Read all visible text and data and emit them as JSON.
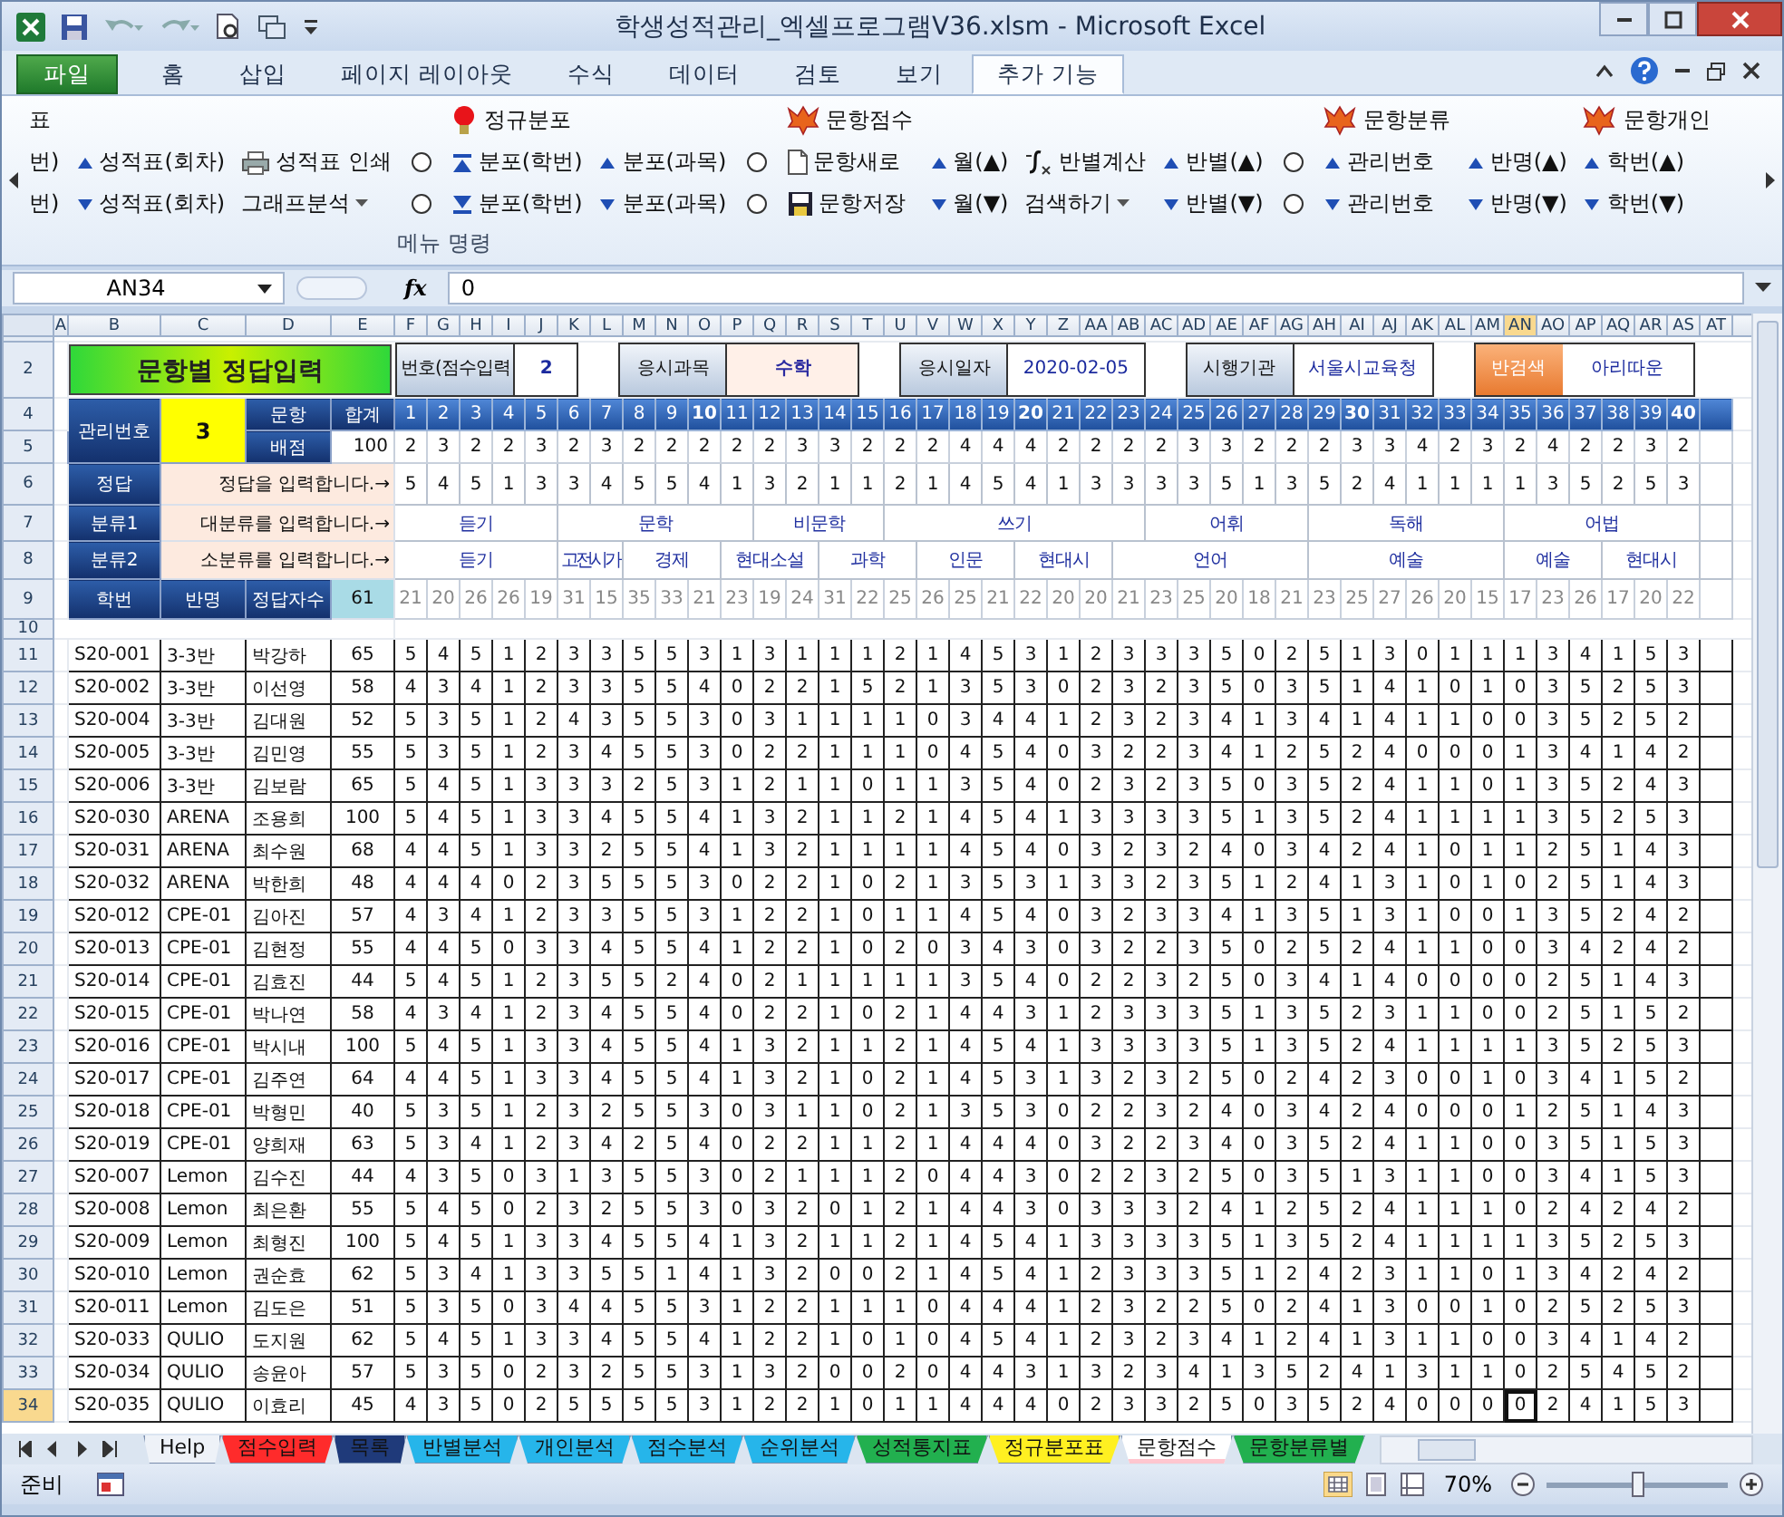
{
  "window": {
    "title": "학생성적관리_엑셀프로그램V36.xlsm  -  Microsoft Excel"
  },
  "ribbon_tabs": [
    {
      "label": "파일",
      "kind": "file",
      "selected": false
    },
    {
      "label": "홈",
      "selected": false
    },
    {
      "label": "삽입",
      "selected": false
    },
    {
      "label": "페이지 레이아웃",
      "selected": false
    },
    {
      "label": "수식",
      "selected": false
    },
    {
      "label": "데이터",
      "selected": false
    },
    {
      "label": "검토",
      "selected": false
    },
    {
      "label": "보기",
      "selected": false
    },
    {
      "label": "추가 기능",
      "selected": true
    }
  ],
  "ribbon": {
    "group_label": "메뉴 명령",
    "columns": [
      {
        "top": {
          "kind": "text",
          "label": "표"
        },
        "mid": {
          "kind": "text",
          "label": "번)"
        },
        "bot": {
          "kind": "text",
          "label": "번)"
        }
      },
      {
        "mid": {
          "kind": "up",
          "label": "성적표(회차)"
        },
        "bot": {
          "kind": "down",
          "label": "성적표(회차)"
        }
      },
      {
        "mid": {
          "kind": "printer",
          "label": "성적표 인쇄"
        },
        "bot": {
          "kind": "dropdown",
          "label": "그래프분석"
        }
      },
      {
        "mid": {
          "kind": "radio",
          "selected": false
        },
        "bot": {
          "kind": "radio",
          "selected": false
        }
      },
      {
        "top": {
          "kind": "bulb",
          "label": "정규분포"
        },
        "mid": {
          "kind": "bar-up",
          "label": "분포(학번)"
        },
        "bot": {
          "kind": "bar-down",
          "label": "분포(학번)"
        }
      },
      {
        "mid": {
          "kind": "up",
          "label": "분포(과목)"
        },
        "bot": {
          "kind": "down",
          "label": "분포(과목)"
        }
      },
      {
        "mid": {
          "kind": "radio",
          "selected": false
        },
        "bot": {
          "kind": "radio",
          "selected": false
        }
      },
      {
        "top": {
          "kind": "fox",
          "label": "문항점수"
        },
        "mid": {
          "kind": "doc",
          "label": "문항새로"
        },
        "bot": {
          "kind": "save",
          "label": "문항저장"
        }
      },
      {
        "mid": {
          "kind": "up",
          "label": "월(▲)"
        },
        "bot": {
          "kind": "down",
          "label": "월(▼)"
        }
      },
      {
        "mid": {
          "kind": "formula",
          "label": "반별계산"
        },
        "bot": {
          "kind": "dropdown",
          "label": "검색하기"
        }
      },
      {
        "mid": {
          "kind": "up",
          "label": "반별(▲)"
        },
        "bot": {
          "kind": "down",
          "label": "반별(▼)"
        }
      },
      {
        "mid": {
          "kind": "radio",
          "selected": false
        },
        "bot": {
          "kind": "radio",
          "selected": false
        }
      },
      {
        "top": {
          "kind": "fox",
          "label": "문항분류"
        },
        "mid": {
          "kind": "up",
          "label": "관리번호"
        },
        "bot": {
          "kind": "down",
          "label": "관리번호"
        }
      },
      {
        "mid": {
          "kind": "up",
          "label": "반명(▲)"
        },
        "bot": {
          "kind": "down",
          "label": "반명(▼)"
        }
      },
      {
        "top": {
          "kind": "fox",
          "label": "문항개인"
        },
        "mid": {
          "kind": "up",
          "label": "학번(▲)"
        },
        "bot": {
          "kind": "down",
          "label": "학번(▼)"
        }
      }
    ]
  },
  "formula_bar": {
    "name_box": "AN34",
    "fx": "fx",
    "value": "0"
  },
  "sheet": {
    "columns": [
      {
        "label": "A",
        "selected": false
      },
      {
        "label": "B",
        "selected": false
      },
      {
        "label": "C",
        "selected": false
      },
      {
        "label": "D",
        "selected": false
      },
      {
        "label": "E",
        "selected": false
      },
      {
        "label": "F",
        "selected": false
      },
      {
        "label": "G",
        "selected": false
      },
      {
        "label": "H",
        "selected": false
      },
      {
        "label": "I",
        "selected": false
      },
      {
        "label": "J",
        "selected": false
      },
      {
        "label": "K",
        "selected": false
      },
      {
        "label": "L",
        "selected": false
      },
      {
        "label": "M",
        "selected": false
      },
      {
        "label": "N",
        "selected": false
      },
      {
        "label": "O",
        "selected": false
      },
      {
        "label": "P",
        "selected": false
      },
      {
        "label": "Q",
        "selected": false
      },
      {
        "label": "R",
        "selected": false
      },
      {
        "label": "S",
        "selected": false
      },
      {
        "label": "T",
        "selected": false
      },
      {
        "label": "U",
        "selected": false
      },
      {
        "label": "V",
        "selected": false
      },
      {
        "label": "W",
        "selected": false
      },
      {
        "label": "X",
        "selected": false
      },
      {
        "label": "Y",
        "selected": false
      },
      {
        "label": "Z",
        "selected": false
      },
      {
        "label": "AA",
        "selected": false
      },
      {
        "label": "AB",
        "selected": false
      },
      {
        "label": "AC",
        "selected": false
      },
      {
        "label": "AD",
        "selected": false
      },
      {
        "label": "AE",
        "selected": false
      },
      {
        "label": "AF",
        "selected": false
      },
      {
        "label": "AG",
        "selected": false
      },
      {
        "label": "AH",
        "selected": false
      },
      {
        "label": "AI",
        "selected": false
      },
      {
        "label": "AJ",
        "selected": false
      },
      {
        "label": "AK",
        "selected": false
      },
      {
        "label": "AL",
        "selected": false
      },
      {
        "label": "AM",
        "selected": false
      },
      {
        "label": "AN",
        "selected": true
      },
      {
        "label": "AO",
        "selected": false
      },
      {
        "label": "AP",
        "selected": false
      },
      {
        "label": "AQ",
        "selected": false
      },
      {
        "label": "AR",
        "selected": false
      },
      {
        "label": "AS",
        "selected": false
      },
      {
        "label": "AT",
        "selected": false
      }
    ],
    "header_rows": [
      "2",
      "4",
      "5",
      "6",
      "7",
      "8",
      "9",
      "10"
    ],
    "title": "문항별 정답입력",
    "info": [
      {
        "label": "번호(점수입력",
        "value": "2",
        "kind": "plain"
      },
      {
        "label": "응시과목",
        "value": "수학",
        "kind": "highlight"
      },
      {
        "label": "응시일자",
        "value": "2020-02-05",
        "kind": "plain"
      },
      {
        "label": "시행기관",
        "value": "서울시교육청",
        "kind": "plain"
      },
      {
        "label": "반검색",
        "value": "아리따운",
        "kind": "search"
      }
    ],
    "header": {
      "manage_label": "관리번호",
      "manage_value": "3",
      "question_label": "문항",
      "total_label": "합계",
      "points_label": "배점",
      "points_total": "100",
      "answer_label": "정답",
      "answer_hint": "정답을 입력합니다.→",
      "cat1_label": "분류1",
      "cat1_hint": "대분류를 입력합니다.→",
      "cat2_label": "분류2",
      "cat2_hint": "소분류를 입력합니다.→",
      "id_label": "학번",
      "class_label": "반명",
      "count_label": "정답자수",
      "count_value": "61"
    },
    "questions": [
      {
        "number": "1",
        "points": "2",
        "answer": "5",
        "correct": "21",
        "category1": "듣기",
        "category2": "듣기"
      },
      {
        "number": "2",
        "points": "3",
        "answer": "4",
        "correct": "20"
      },
      {
        "number": "3",
        "points": "2",
        "answer": "5",
        "correct": "26"
      },
      {
        "number": "4",
        "points": "2",
        "answer": "1",
        "correct": "26"
      },
      {
        "number": "5",
        "points": "3",
        "answer": "3",
        "correct": "19"
      },
      {
        "number": "6",
        "points": "2",
        "answer": "3",
        "correct": "31",
        "category1": "문학",
        "category2": "고전시가"
      },
      {
        "number": "7",
        "points": "3",
        "answer": "4",
        "correct": "15"
      },
      {
        "number": "8",
        "points": "2",
        "answer": "5",
        "correct": "35",
        "category2": "경제"
      },
      {
        "number": "9",
        "points": "2",
        "answer": "5",
        "correct": "33"
      },
      {
        "number": "10",
        "points": "2",
        "answer": "4",
        "correct": "21"
      },
      {
        "number": "11",
        "points": "2",
        "answer": "1",
        "correct": "23",
        "category2": "현대소설"
      },
      {
        "number": "12",
        "points": "2",
        "answer": "3",
        "correct": "19",
        "category1": "비문학"
      },
      {
        "number": "13",
        "points": "3",
        "answer": "2",
        "correct": "24"
      },
      {
        "number": "14",
        "points": "3",
        "answer": "1",
        "correct": "31",
        "category2": "과학"
      },
      {
        "number": "15",
        "points": "2",
        "answer": "1",
        "correct": "22"
      },
      {
        "number": "16",
        "points": "2",
        "answer": "2",
        "correct": "25",
        "category1": "쓰기"
      },
      {
        "number": "17",
        "points": "2",
        "answer": "1",
        "correct": "26",
        "category2": "인문"
      },
      {
        "number": "18",
        "points": "4",
        "answer": "4",
        "correct": "25"
      },
      {
        "number": "19",
        "points": "4",
        "answer": "5",
        "correct": "21"
      },
      {
        "number": "20",
        "points": "4",
        "answer": "4",
        "correct": "22",
        "category2": "현대시"
      },
      {
        "number": "21",
        "points": "2",
        "answer": "1",
        "correct": "20"
      },
      {
        "number": "22",
        "points": "2",
        "answer": "3",
        "correct": "20"
      },
      {
        "number": "23",
        "points": "2",
        "answer": "3",
        "correct": "21",
        "category2": "언어"
      },
      {
        "number": "24",
        "points": "2",
        "answer": "3",
        "correct": "23",
        "category1": "어휘"
      },
      {
        "number": "25",
        "points": "3",
        "answer": "3",
        "correct": "25"
      },
      {
        "number": "26",
        "points": "3",
        "answer": "5",
        "correct": "20"
      },
      {
        "number": "27",
        "points": "2",
        "answer": "1",
        "correct": "18"
      },
      {
        "number": "28",
        "points": "2",
        "answer": "3",
        "correct": "21"
      },
      {
        "number": "29",
        "points": "2",
        "answer": "5",
        "correct": "23",
        "category1": "독해",
        "category2": "예술"
      },
      {
        "number": "30",
        "points": "3",
        "answer": "2",
        "correct": "25"
      },
      {
        "number": "31",
        "points": "3",
        "answer": "4",
        "correct": "27"
      },
      {
        "number": "32",
        "points": "4",
        "answer": "1",
        "correct": "26"
      },
      {
        "number": "33",
        "points": "2",
        "answer": "1",
        "correct": "20"
      },
      {
        "number": "34",
        "points": "3",
        "answer": "1",
        "correct": "15"
      },
      {
        "number": "35",
        "points": "2",
        "answer": "1",
        "correct": "17",
        "category1": "어법",
        "category2": "예술"
      },
      {
        "number": "36",
        "points": "4",
        "answer": "3",
        "correct": "23"
      },
      {
        "number": "37",
        "points": "2",
        "answer": "5",
        "correct": "26"
      },
      {
        "number": "38",
        "points": "2",
        "answer": "2",
        "correct": "17",
        "category2": "현대시"
      },
      {
        "number": "39",
        "points": "3",
        "answer": "5",
        "correct": "20"
      },
      {
        "number": "40",
        "points": "2",
        "answer": "3",
        "correct": "22"
      }
    ],
    "students": [
      {
        "row": "11",
        "selected": false,
        "id": "S20-001",
        "class": "3-3반",
        "name": "박강하",
        "score": "65",
        "answers": [
          "5",
          "4",
          "5",
          "1",
          "2",
          "3",
          "3",
          "5",
          "5",
          "3",
          "1",
          "3",
          "1",
          "1",
          "1",
          "2",
          "1",
          "4",
          "5",
          "3",
          "1",
          "2",
          "3",
          "3",
          "3",
          "5",
          "0",
          "2",
          "5",
          "1",
          "3",
          "0",
          "1",
          "1",
          "1",
          "3",
          "4",
          "1",
          "5",
          "3"
        ]
      },
      {
        "row": "12",
        "selected": false,
        "id": "S20-002",
        "class": "3-3반",
        "name": "이선영",
        "score": "58",
        "answers": [
          "4",
          "3",
          "4",
          "1",
          "2",
          "3",
          "3",
          "5",
          "5",
          "4",
          "0",
          "2",
          "2",
          "1",
          "5",
          "2",
          "1",
          "3",
          "5",
          "3",
          "0",
          "2",
          "3",
          "2",
          "3",
          "5",
          "0",
          "3",
          "5",
          "1",
          "4",
          "1",
          "0",
          "1",
          "0",
          "3",
          "5",
          "2",
          "5",
          "3"
        ]
      },
      {
        "row": "13",
        "selected": false,
        "id": "S20-004",
        "class": "3-3반",
        "name": "김대원",
        "score": "52",
        "answers": [
          "5",
          "3",
          "5",
          "1",
          "2",
          "4",
          "3",
          "5",
          "5",
          "3",
          "0",
          "3",
          "1",
          "1",
          "1",
          "1",
          "0",
          "3",
          "4",
          "4",
          "1",
          "2",
          "3",
          "2",
          "3",
          "4",
          "1",
          "3",
          "4",
          "1",
          "4",
          "1",
          "1",
          "0",
          "0",
          "3",
          "5",
          "2",
          "5",
          "2"
        ]
      },
      {
        "row": "14",
        "selected": false,
        "id": "S20-005",
        "class": "3-3반",
        "name": "김민영",
        "score": "55",
        "answers": [
          "5",
          "3",
          "5",
          "1",
          "2",
          "3",
          "4",
          "5",
          "5",
          "3",
          "0",
          "2",
          "2",
          "1",
          "1",
          "1",
          "0",
          "4",
          "5",
          "4",
          "0",
          "3",
          "2",
          "2",
          "3",
          "4",
          "1",
          "2",
          "5",
          "2",
          "4",
          "0",
          "0",
          "0",
          "1",
          "3",
          "4",
          "1",
          "4",
          "2"
        ]
      },
      {
        "row": "15",
        "selected": false,
        "id": "S20-006",
        "class": "3-3반",
        "name": "김보람",
        "score": "65",
        "answers": [
          "5",
          "4",
          "5",
          "1",
          "3",
          "3",
          "3",
          "2",
          "5",
          "3",
          "1",
          "2",
          "1",
          "1",
          "0",
          "1",
          "1",
          "3",
          "5",
          "4",
          "0",
          "2",
          "3",
          "2",
          "3",
          "5",
          "0",
          "3",
          "5",
          "2",
          "4",
          "1",
          "1",
          "0",
          "1",
          "3",
          "5",
          "2",
          "4",
          "3"
        ]
      },
      {
        "row": "16",
        "selected": false,
        "id": "S20-030",
        "class": "ARENA",
        "name": "조용희",
        "score": "100",
        "answers": [
          "5",
          "4",
          "5",
          "1",
          "3",
          "3",
          "4",
          "5",
          "5",
          "4",
          "1",
          "3",
          "2",
          "1",
          "1",
          "2",
          "1",
          "4",
          "5",
          "4",
          "1",
          "3",
          "3",
          "3",
          "3",
          "5",
          "1",
          "3",
          "5",
          "2",
          "4",
          "1",
          "1",
          "1",
          "1",
          "3",
          "5",
          "2",
          "5",
          "3"
        ]
      },
      {
        "row": "17",
        "selected": false,
        "id": "S20-031",
        "class": "ARENA",
        "name": "최수원",
        "score": "68",
        "answers": [
          "4",
          "4",
          "5",
          "1",
          "3",
          "3",
          "2",
          "5",
          "5",
          "4",
          "1",
          "3",
          "2",
          "1",
          "1",
          "1",
          "1",
          "4",
          "5",
          "4",
          "0",
          "3",
          "2",
          "3",
          "2",
          "4",
          "0",
          "3",
          "4",
          "2",
          "4",
          "1",
          "0",
          "1",
          "1",
          "2",
          "5",
          "1",
          "4",
          "3"
        ]
      },
      {
        "row": "18",
        "selected": false,
        "id": "S20-032",
        "class": "ARENA",
        "name": "박한희",
        "score": "48",
        "answers": [
          "4",
          "4",
          "4",
          "0",
          "2",
          "3",
          "5",
          "5",
          "5",
          "3",
          "0",
          "2",
          "2",
          "1",
          "0",
          "2",
          "1",
          "3",
          "5",
          "3",
          "1",
          "3",
          "3",
          "2",
          "3",
          "5",
          "1",
          "2",
          "4",
          "1",
          "3",
          "1",
          "0",
          "1",
          "0",
          "2",
          "5",
          "1",
          "4",
          "3"
        ]
      },
      {
        "row": "19",
        "selected": false,
        "id": "S20-012",
        "class": "CPE-01",
        "name": "김아진",
        "score": "57",
        "answers": [
          "4",
          "3",
          "4",
          "1",
          "2",
          "3",
          "3",
          "5",
          "5",
          "3",
          "1",
          "2",
          "2",
          "1",
          "0",
          "1",
          "1",
          "4",
          "5",
          "4",
          "0",
          "3",
          "2",
          "3",
          "3",
          "4",
          "1",
          "3",
          "5",
          "1",
          "3",
          "1",
          "0",
          "0",
          "1",
          "3",
          "5",
          "2",
          "4",
          "2"
        ]
      },
      {
        "row": "20",
        "selected": false,
        "id": "S20-013",
        "class": "CPE-01",
        "name": "김현정",
        "score": "55",
        "answers": [
          "4",
          "4",
          "5",
          "0",
          "3",
          "3",
          "4",
          "5",
          "5",
          "4",
          "1",
          "2",
          "2",
          "1",
          "0",
          "2",
          "0",
          "3",
          "4",
          "3",
          "0",
          "3",
          "2",
          "2",
          "3",
          "5",
          "0",
          "2",
          "5",
          "2",
          "4",
          "1",
          "1",
          "0",
          "0",
          "3",
          "4",
          "2",
          "4",
          "2"
        ]
      },
      {
        "row": "21",
        "selected": false,
        "id": "S20-014",
        "class": "CPE-01",
        "name": "김효진",
        "score": "44",
        "answers": [
          "5",
          "4",
          "5",
          "1",
          "2",
          "3",
          "5",
          "5",
          "2",
          "4",
          "0",
          "2",
          "1",
          "1",
          "1",
          "1",
          "1",
          "3",
          "5",
          "4",
          "0",
          "2",
          "2",
          "3",
          "2",
          "5",
          "0",
          "3",
          "4",
          "1",
          "4",
          "0",
          "0",
          "0",
          "0",
          "2",
          "5",
          "1",
          "4",
          "3"
        ]
      },
      {
        "row": "22",
        "selected": false,
        "id": "S20-015",
        "class": "CPE-01",
        "name": "박나연",
        "score": "58",
        "answers": [
          "4",
          "3",
          "4",
          "1",
          "2",
          "3",
          "4",
          "5",
          "5",
          "4",
          "0",
          "2",
          "2",
          "1",
          "0",
          "2",
          "1",
          "4",
          "4",
          "3",
          "1",
          "2",
          "3",
          "3",
          "3",
          "5",
          "1",
          "3",
          "5",
          "2",
          "3",
          "1",
          "1",
          "0",
          "0",
          "2",
          "5",
          "1",
          "5",
          "2"
        ]
      },
      {
        "row": "23",
        "selected": false,
        "id": "S20-016",
        "class": "CPE-01",
        "name": "박시내",
        "score": "100",
        "answers": [
          "5",
          "4",
          "5",
          "1",
          "3",
          "3",
          "4",
          "5",
          "5",
          "4",
          "1",
          "3",
          "2",
          "1",
          "1",
          "2",
          "1",
          "4",
          "5",
          "4",
          "1",
          "3",
          "3",
          "3",
          "3",
          "5",
          "1",
          "3",
          "5",
          "2",
          "4",
          "1",
          "1",
          "1",
          "1",
          "3",
          "5",
          "2",
          "5",
          "3"
        ]
      },
      {
        "row": "24",
        "selected": false,
        "id": "S20-017",
        "class": "CPE-01",
        "name": "김주연",
        "score": "64",
        "answers": [
          "4",
          "4",
          "5",
          "1",
          "3",
          "3",
          "4",
          "5",
          "5",
          "4",
          "1",
          "3",
          "2",
          "1",
          "0",
          "2",
          "1",
          "4",
          "5",
          "3",
          "1",
          "3",
          "2",
          "3",
          "2",
          "5",
          "0",
          "2",
          "4",
          "2",
          "3",
          "0",
          "0",
          "1",
          "0",
          "3",
          "4",
          "1",
          "5",
          "2"
        ]
      },
      {
        "row": "25",
        "selected": false,
        "id": "S20-018",
        "class": "CPE-01",
        "name": "박형민",
        "score": "40",
        "answers": [
          "5",
          "3",
          "5",
          "1",
          "2",
          "3",
          "2",
          "5",
          "5",
          "3",
          "0",
          "3",
          "1",
          "1",
          "0",
          "2",
          "1",
          "3",
          "5",
          "3",
          "0",
          "2",
          "2",
          "3",
          "2",
          "4",
          "0",
          "3",
          "4",
          "2",
          "4",
          "0",
          "0",
          "0",
          "1",
          "2",
          "5",
          "1",
          "4",
          "3"
        ]
      },
      {
        "row": "26",
        "selected": false,
        "id": "S20-019",
        "class": "CPE-01",
        "name": "양희재",
        "score": "63",
        "answers": [
          "5",
          "3",
          "4",
          "1",
          "2",
          "3",
          "4",
          "2",
          "5",
          "4",
          "0",
          "2",
          "2",
          "1",
          "1",
          "2",
          "1",
          "4",
          "4",
          "4",
          "0",
          "3",
          "2",
          "2",
          "3",
          "4",
          "0",
          "3",
          "5",
          "2",
          "4",
          "1",
          "1",
          "0",
          "0",
          "3",
          "5",
          "1",
          "5",
          "3"
        ]
      },
      {
        "row": "27",
        "selected": false,
        "id": "S20-007",
        "class": "Lemon",
        "name": "김수진",
        "score": "44",
        "answers": [
          "4",
          "3",
          "5",
          "0",
          "3",
          "1",
          "3",
          "5",
          "5",
          "3",
          "0",
          "2",
          "1",
          "1",
          "1",
          "2",
          "0",
          "4",
          "4",
          "3",
          "0",
          "2",
          "2",
          "3",
          "2",
          "5",
          "0",
          "3",
          "5",
          "1",
          "3",
          "1",
          "1",
          "0",
          "0",
          "3",
          "4",
          "1",
          "5",
          "3"
        ]
      },
      {
        "row": "28",
        "selected": false,
        "id": "S20-008",
        "class": "Lemon",
        "name": "최은환",
        "score": "55",
        "answers": [
          "5",
          "4",
          "5",
          "0",
          "2",
          "3",
          "2",
          "5",
          "5",
          "3",
          "0",
          "3",
          "2",
          "0",
          "1",
          "2",
          "1",
          "4",
          "4",
          "3",
          "0",
          "3",
          "3",
          "3",
          "2",
          "4",
          "1",
          "2",
          "5",
          "2",
          "4",
          "1",
          "1",
          "1",
          "0",
          "2",
          "4",
          "2",
          "4",
          "2"
        ]
      },
      {
        "row": "29",
        "selected": false,
        "id": "S20-009",
        "class": "Lemon",
        "name": "최형진",
        "score": "100",
        "answers": [
          "5",
          "4",
          "5",
          "1",
          "3",
          "3",
          "4",
          "5",
          "5",
          "4",
          "1",
          "3",
          "2",
          "1",
          "1",
          "2",
          "1",
          "4",
          "5",
          "4",
          "1",
          "3",
          "3",
          "3",
          "3",
          "5",
          "1",
          "3",
          "5",
          "2",
          "4",
          "1",
          "1",
          "1",
          "1",
          "3",
          "5",
          "2",
          "5",
          "3"
        ]
      },
      {
        "row": "30",
        "selected": false,
        "id": "S20-010",
        "class": "Lemon",
        "name": "권순효",
        "score": "62",
        "answers": [
          "5",
          "3",
          "4",
          "1",
          "3",
          "3",
          "5",
          "5",
          "1",
          "4",
          "1",
          "3",
          "2",
          "0",
          "0",
          "2",
          "1",
          "4",
          "5",
          "4",
          "1",
          "2",
          "3",
          "3",
          "3",
          "5",
          "1",
          "2",
          "4",
          "2",
          "3",
          "1",
          "1",
          "0",
          "1",
          "3",
          "4",
          "2",
          "4",
          "2"
        ]
      },
      {
        "row": "31",
        "selected": false,
        "id": "S20-011",
        "class": "Lemon",
        "name": "김도은",
        "score": "51",
        "answers": [
          "5",
          "3",
          "5",
          "0",
          "3",
          "4",
          "4",
          "5",
          "5",
          "3",
          "1",
          "2",
          "2",
          "1",
          "1",
          "1",
          "0",
          "4",
          "4",
          "4",
          "1",
          "2",
          "3",
          "2",
          "2",
          "5",
          "0",
          "2",
          "4",
          "1",
          "3",
          "0",
          "0",
          "1",
          "0",
          "2",
          "5",
          "2",
          "5",
          "3"
        ]
      },
      {
        "row": "32",
        "selected": false,
        "id": "S20-033",
        "class": "QULIO",
        "name": "도지원",
        "score": "62",
        "answers": [
          "5",
          "4",
          "5",
          "1",
          "3",
          "3",
          "4",
          "5",
          "5",
          "4",
          "1",
          "2",
          "2",
          "1",
          "0",
          "1",
          "0",
          "4",
          "5",
          "4",
          "1",
          "2",
          "3",
          "2",
          "3",
          "4",
          "1",
          "2",
          "4",
          "1",
          "3",
          "1",
          "1",
          "0",
          "0",
          "3",
          "4",
          "1",
          "4",
          "2"
        ]
      },
      {
        "row": "33",
        "selected": false,
        "id": "S20-034",
        "class": "QULIO",
        "name": "송윤아",
        "score": "57",
        "answers": [
          "5",
          "3",
          "5",
          "0",
          "2",
          "3",
          "2",
          "5",
          "5",
          "3",
          "1",
          "3",
          "2",
          "0",
          "0",
          "2",
          "0",
          "4",
          "4",
          "3",
          "1",
          "3",
          "2",
          "3",
          "4",
          "1",
          "3",
          "5",
          "2",
          "4",
          "1",
          "3",
          "1",
          "1",
          "0",
          "2",
          "5",
          "4",
          "5",
          "2"
        ]
      },
      {
        "row": "34",
        "selected": true,
        "id": "S20-035",
        "class": "QULIO",
        "name": "이효리",
        "score": "45",
        "answers": [
          "4",
          "3",
          "5",
          "0",
          "2",
          "5",
          "5",
          "5",
          "5",
          "3",
          "1",
          "2",
          "2",
          "1",
          "0",
          "1",
          "1",
          "4",
          "4",
          "4",
          "0",
          "2",
          "3",
          "3",
          "2",
          "5",
          "0",
          "3",
          "5",
          "2",
          "4",
          "0",
          "0",
          "0",
          "0",
          "2",
          "4",
          "1",
          "5",
          "3"
        ]
      }
    ]
  },
  "sheet_tabs": [
    {
      "label": "Help",
      "selected": false
    },
    {
      "label": "점수입력",
      "color": "#ff2b2b",
      "selected": false
    },
    {
      "label": "목록",
      "color": "#1f3a7a",
      "selected": false
    },
    {
      "label": "반별분석",
      "color": "#26b5ea",
      "selected": false
    },
    {
      "label": "개인분석",
      "color": "#26b5ea",
      "selected": false
    },
    {
      "label": "점수분석",
      "color": "#26b5ea",
      "selected": false
    },
    {
      "label": "순위분석",
      "color": "#26b5ea",
      "selected": false
    },
    {
      "label": "성적통지표",
      "color": "#22b04f",
      "selected": false
    },
    {
      "label": "정규분포표",
      "color": "#fff021",
      "selected": false
    },
    {
      "label": "문항점수",
      "color": "#ffc6cf",
      "selected": true
    },
    {
      "label": "문항분류별",
      "color": "#22b04f",
      "selected": false
    }
  ],
  "status_bar": {
    "status": "준비",
    "zoom": "70%",
    "level": 0.5
  }
}
